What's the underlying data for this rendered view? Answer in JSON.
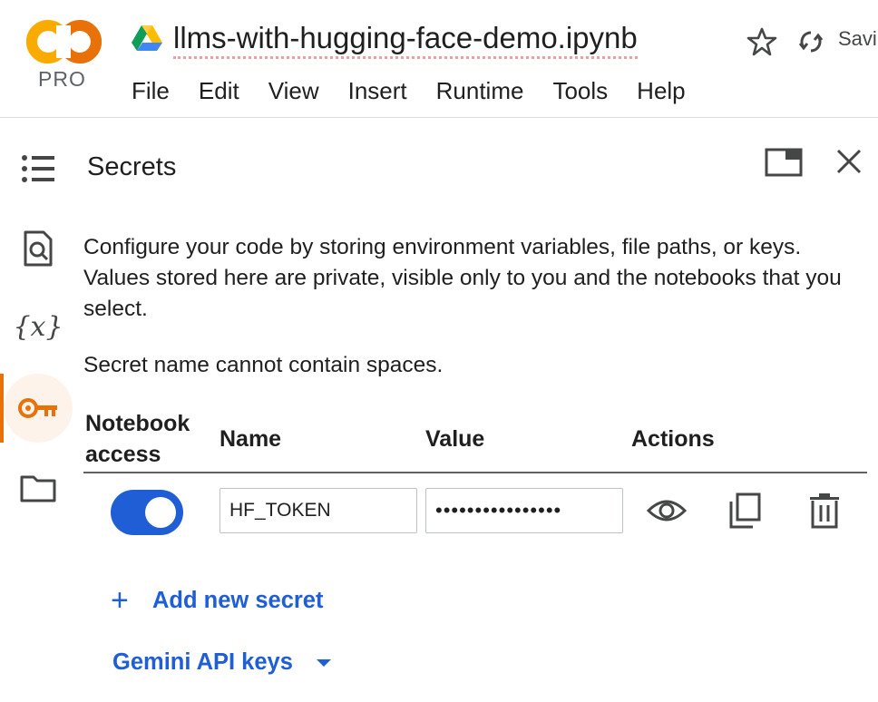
{
  "header": {
    "logo_badge": "PRO",
    "title": "llms-with-hugging-face-demo.ipynb",
    "saving_text": "Savi",
    "menu": [
      "File",
      "Edit",
      "View",
      "Insert",
      "Runtime",
      "Tools",
      "Help"
    ],
    "icons": [
      "colab-logo",
      "drive-icon",
      "star-icon",
      "sync-icon"
    ]
  },
  "rail": {
    "items": [
      "table-of-contents-icon",
      "find-icon",
      "variables-icon",
      "key-icon",
      "folder-icon"
    ],
    "variables_glyph": "{x}",
    "active": "key-icon",
    "accent": "#e8710a"
  },
  "panel": {
    "title": "Secrets",
    "description": "Configure your code by storing environment variables, file paths, or keys. Values stored here are private, visible only to you and the notebooks that you select.",
    "note": "Secret name cannot contain spaces.",
    "columns": {
      "access": "Notebook access",
      "name": "Name",
      "value": "Value",
      "actions": "Actions"
    },
    "secrets": [
      {
        "notebook_access": true,
        "name": "HF_TOKEN",
        "value_masked": "••••••••••••••••"
      }
    ],
    "add_label": "Add new secret",
    "add_glyph": "+",
    "gemini_label": "Gemini API keys",
    "link_color": "#1f5ed4"
  }
}
